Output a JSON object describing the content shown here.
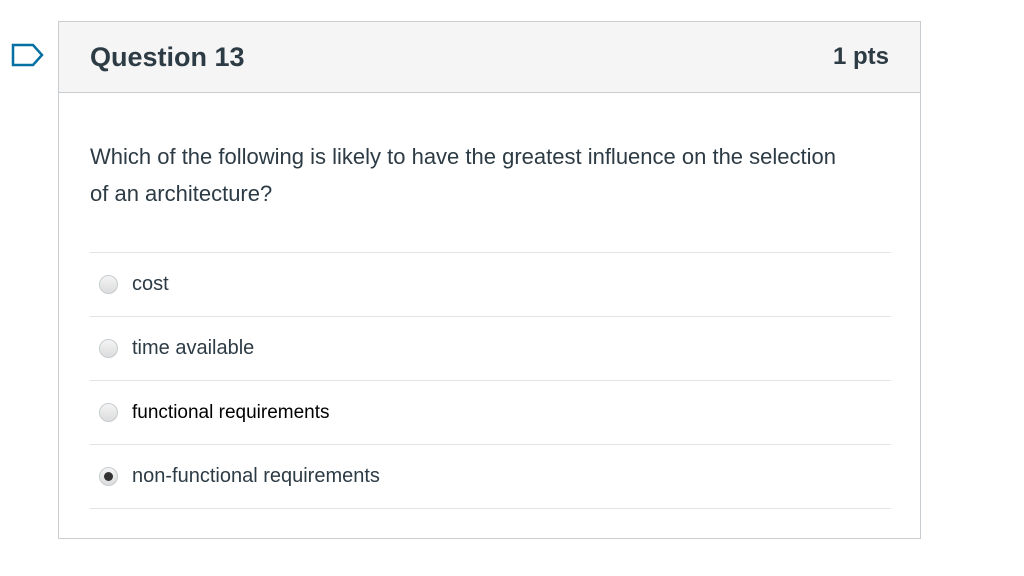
{
  "question": {
    "title": "Question 13",
    "points": "1 pts",
    "text": "Which of the following is likely to have the greatest influence on the selection of an architecture?",
    "flag_icon": "flag-outline-icon"
  },
  "answers": [
    {
      "label": "cost",
      "selected": false
    },
    {
      "label": "time available",
      "selected": false
    },
    {
      "label": "functional requirements",
      "selected": false
    },
    {
      "label": "non-functional requirements",
      "selected": true
    }
  ],
  "colors": {
    "accent": "#0770a3",
    "text": "#2d3b45",
    "header_bg": "#f5f5f5",
    "border": "#c7cdd1"
  }
}
